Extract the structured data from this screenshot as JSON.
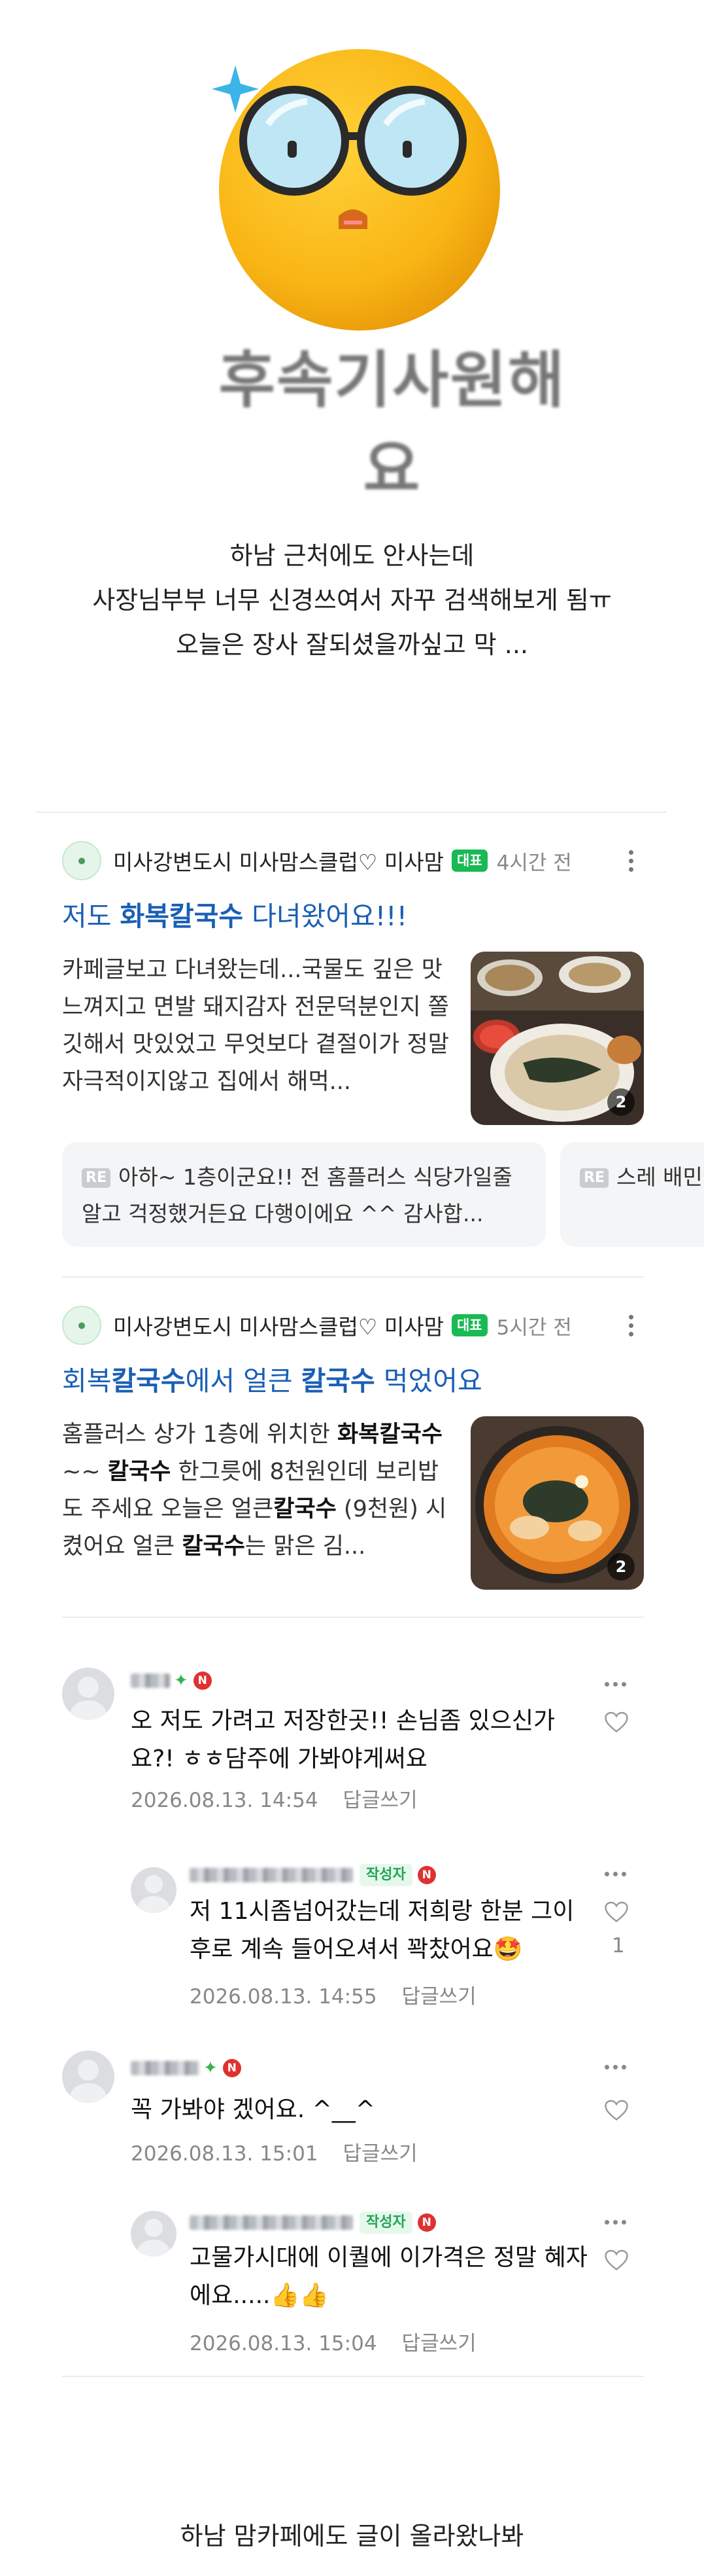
{
  "sticker": {
    "text": "후속기사원해요"
  },
  "intro": {
    "lines": [
      "하남 근처에도 안사는데",
      "사장님부부 너무 신경쓰여서 자꾸 검색해보게 됨ㅠ",
      "오늘은 장사 잘되셨을까싶고 막 ..."
    ]
  },
  "posts": [
    {
      "cafe_name": "미사강변도시 미사맘스클럽♡ 미사맘",
      "badge": "대표",
      "time": "4시간 전",
      "title_pre": "저도 ",
      "title_kw": "화복칼국수",
      "title_post": " 다녀왔어요!!!",
      "excerpt": "카페글보고 다녀왔는데...국물도 깊은 맛 느껴지고 면발 돼지감자 전문덕분인지 쫄깃해서 맛있었고 무엇보다 곁절이가 정말 자극적이지않고 집에서 해먹...",
      "image_count": "2"
    },
    {
      "cafe_name": "미사강변도시 미사맘스클럽♡ 미사맘",
      "badge": "대표",
      "time": "5시간 전",
      "title_a": "회복",
      "title_b": "칼국수",
      "title_c": "에서 얼큰 ",
      "title_d": "칼국수",
      "title_e": " 먹었어요",
      "ex_1": "홈플러스 상가 1층에 위치한 ",
      "ex_2": "화복칼국수",
      "ex_3": " ~~ ",
      "ex_4": "칼국수",
      "ex_5": " 한그릇에 8천원인데 보리밥도 주세요 오늘은 얼큰",
      "ex_6": "칼국수",
      "ex_7": " (9천원) 시켰어요 얼큰 ",
      "ex_8": "칼국수",
      "ex_9": "는 맑은 김...",
      "image_count": "2"
    }
  ],
  "reply_previews": [
    {
      "tag": "RE",
      "text": "아하~ 1층이군요!! 전 홈플러스 식당가일줄 알고 걱정했거든요 다행이에요 ^^ 감사합..."
    },
    {
      "tag": "RE",
      "text": "스레 배민에 칮"
    }
  ],
  "comments": [
    {
      "text": "오 저도 가려고 저장한곳!! 손님좀 있으신가요?! ㅎㅎ담주에 가봐야게써요",
      "date": "2026.08.13. 14:54",
      "reply_label": "답글쓰기"
    },
    {
      "author_badge": "작성자",
      "text": "저 11시좀넘어갔는데 저희랑 한분 그이후로 계속 들어오셔서 꽉찼어요🤩",
      "date": "2026.08.13. 14:55",
      "reply_label": "답글쓰기",
      "likes": "1"
    },
    {
      "text": "꼭 가봐야 겠어요. ^__^",
      "date": "2026.08.13. 15:01",
      "reply_label": "답글쓰기"
    },
    {
      "author_badge": "작성자",
      "text": "고물가시대에 이퀄에 이가격은 정말 혜자에요.....👍👍",
      "date": "2026.08.13. 15:04",
      "reply_label": "답글쓰기"
    }
  ],
  "outro": "하남 맘카페에도 글이 올라왔나봐",
  "colors": {
    "link_blue": "#1a5fb4",
    "rep_green": "#19b954",
    "n_red": "#e03131"
  },
  "icons": [
    "glasses-emoji-sticker",
    "kebab-menu-icon",
    "heart-outline-icon",
    "sprout-icon",
    "naver-n-icon"
  ]
}
